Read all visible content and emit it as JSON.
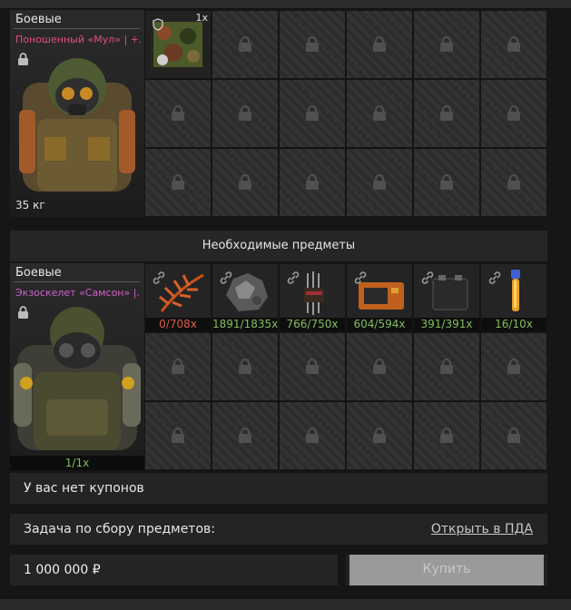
{
  "suit1": {
    "category": "Боевые",
    "name": "Поношенный «Мул» | +..",
    "name_color": "#e0507a",
    "weight": "35 кг",
    "item_qty": "1x"
  },
  "required_header": "Необходимые предметы",
  "suit2": {
    "category": "Боевые",
    "name": "Экзоскелет «Самсон» |..",
    "name_color": "#d060d0",
    "count": "1/1x"
  },
  "required_items": [
    {
      "name": "fern-leaf",
      "qty": "0/708x",
      "enough": false
    },
    {
      "name": "rock-ore",
      "qty": "1891/1835x",
      "enough": true
    },
    {
      "name": "electronic-component",
      "qty": "766/750x",
      "enough": true
    },
    {
      "name": "orange-device",
      "qty": "604/594x",
      "enough": true
    },
    {
      "name": "battery",
      "qty": "391/391x",
      "enough": true
    },
    {
      "name": "glowing-vial",
      "qty": "16/10x",
      "enough": true
    }
  ],
  "no_coupons": "У вас нет купонов",
  "task_label": "Задача по сбору предметов:",
  "task_link": "Открыть в ПДА",
  "price": "1 000 000 ₽",
  "buy_label": "Купить"
}
